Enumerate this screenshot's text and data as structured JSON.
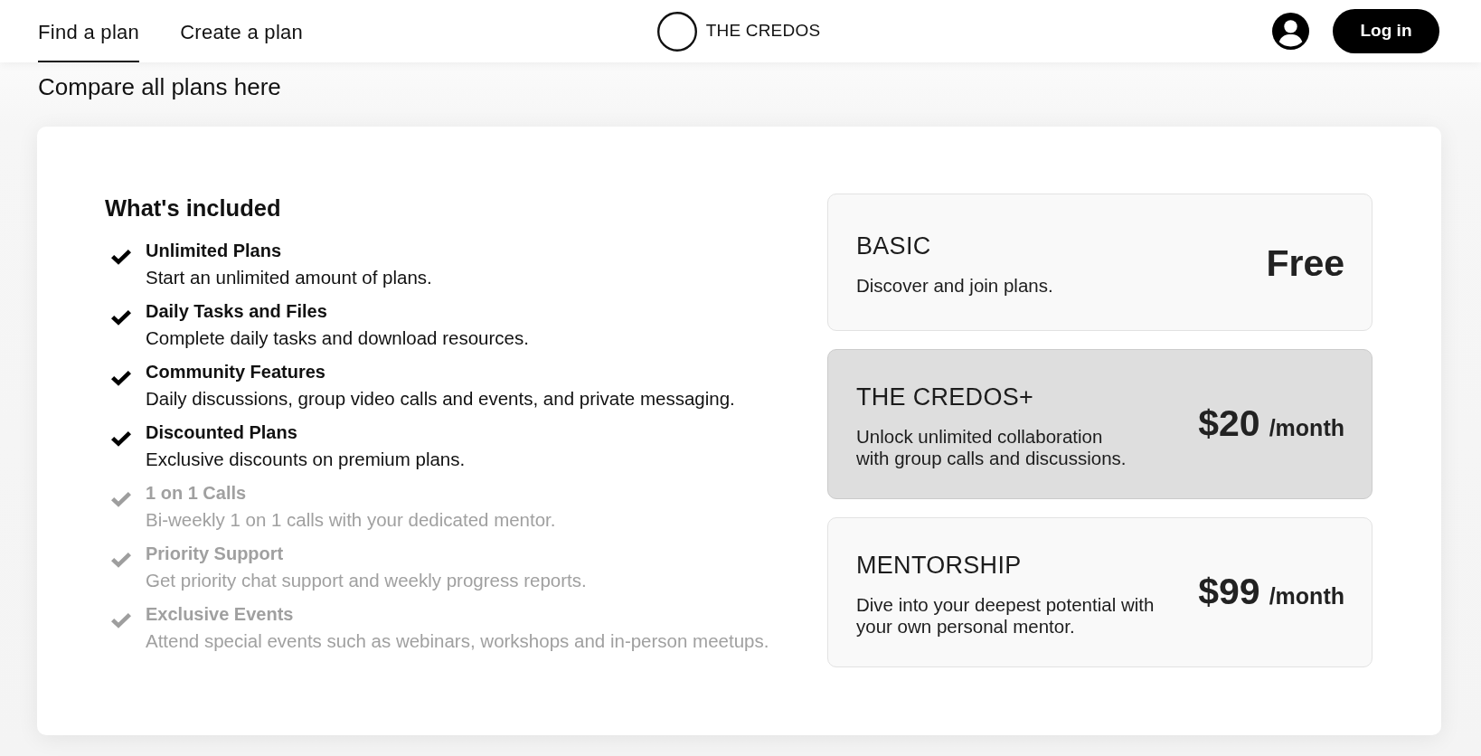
{
  "nav": {
    "tabs": [
      {
        "label": "Find a plan",
        "selected": true
      },
      {
        "label": "Create a plan",
        "selected": false
      }
    ],
    "logo": "THE CREDOS",
    "login_button": "Log in"
  },
  "heading": "Compare all plans here",
  "features": {
    "title": "What's included",
    "items": [
      {
        "title": "Unlimited Plans",
        "description": "Start an unlimited amount of plans.",
        "included": true
      },
      {
        "title": "Daily Tasks and Files",
        "description": "Complete daily tasks and download resources.",
        "included": true
      },
      {
        "title": "Community Features",
        "description": "Daily discussions, group video calls and events, and private messaging.",
        "included": true
      },
      {
        "title": "Discounted Plans",
        "description": "Exclusive discounts on premium plans.",
        "included": true
      },
      {
        "title": "1 on 1 Calls",
        "description": "Bi-weekly 1 on 1 calls with your dedicated mentor.",
        "included": false
      },
      {
        "title": "Priority Support",
        "description": "Get priority chat support and weekly progress reports.",
        "included": false
      },
      {
        "title": "Exclusive Events",
        "description": "Attend special events such as webinars, workshops and in-person meetups.",
        "included": false
      }
    ]
  },
  "plans": [
    {
      "name": "BASIC",
      "description": "Discover and join plans.",
      "price": "Free",
      "selected": false
    },
    {
      "name": "THE CREDOS+",
      "description": "Unlock unlimited collaboration\nwith group calls and discussions.",
      "price": "$20",
      "period": "/month",
      "selected": true
    },
    {
      "name": "MENTORSHIP",
      "description": "Dive into your deepest potential with\nyour own personal mentor.",
      "price": "$99",
      "period": "/month",
      "selected": false
    }
  ]
}
